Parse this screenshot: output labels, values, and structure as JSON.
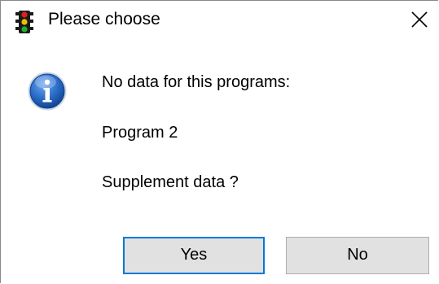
{
  "window": {
    "title": "Please choose",
    "app_icon": "traffic-light-icon",
    "close_icon": "close-icon"
  },
  "message": {
    "icon": "info-icon",
    "line1": "No data for this programs:",
    "line2": "Program 2",
    "line3": "Supplement data ?"
  },
  "buttons": {
    "yes_label": "Yes",
    "no_label": "No"
  },
  "colors": {
    "focus_border": "#0078d7",
    "button_face": "#e1e1e1",
    "info_blue": "#1f5fb7"
  }
}
